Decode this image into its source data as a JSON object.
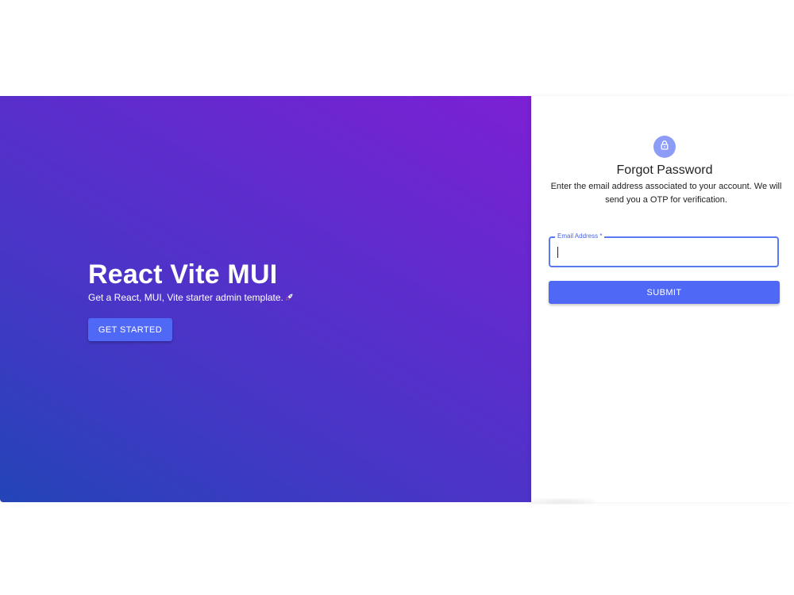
{
  "hero": {
    "title": "React Vite MUI",
    "subtitle": "Get a React, MUI, Vite starter admin template.",
    "subtitle_icon": "rocket-icon",
    "button_label": "GET STARTED",
    "gradient_colors": [
      "#2344b8",
      "#4736c6",
      "#5f2ccd",
      "#7c20d4"
    ]
  },
  "form": {
    "icon": "lock-icon",
    "icon_bg_color": "#8c9cf7",
    "title": "Forgot Password",
    "description": "Enter the email address associated to your account. We will send you a OTP for verification.",
    "email_field": {
      "label": "Email Address *",
      "value": "",
      "focus_color": "#5a78f0"
    },
    "submit_label": "SUBMIT"
  },
  "colors": {
    "primary_button": "#5068f6",
    "background": "#ffffff"
  }
}
